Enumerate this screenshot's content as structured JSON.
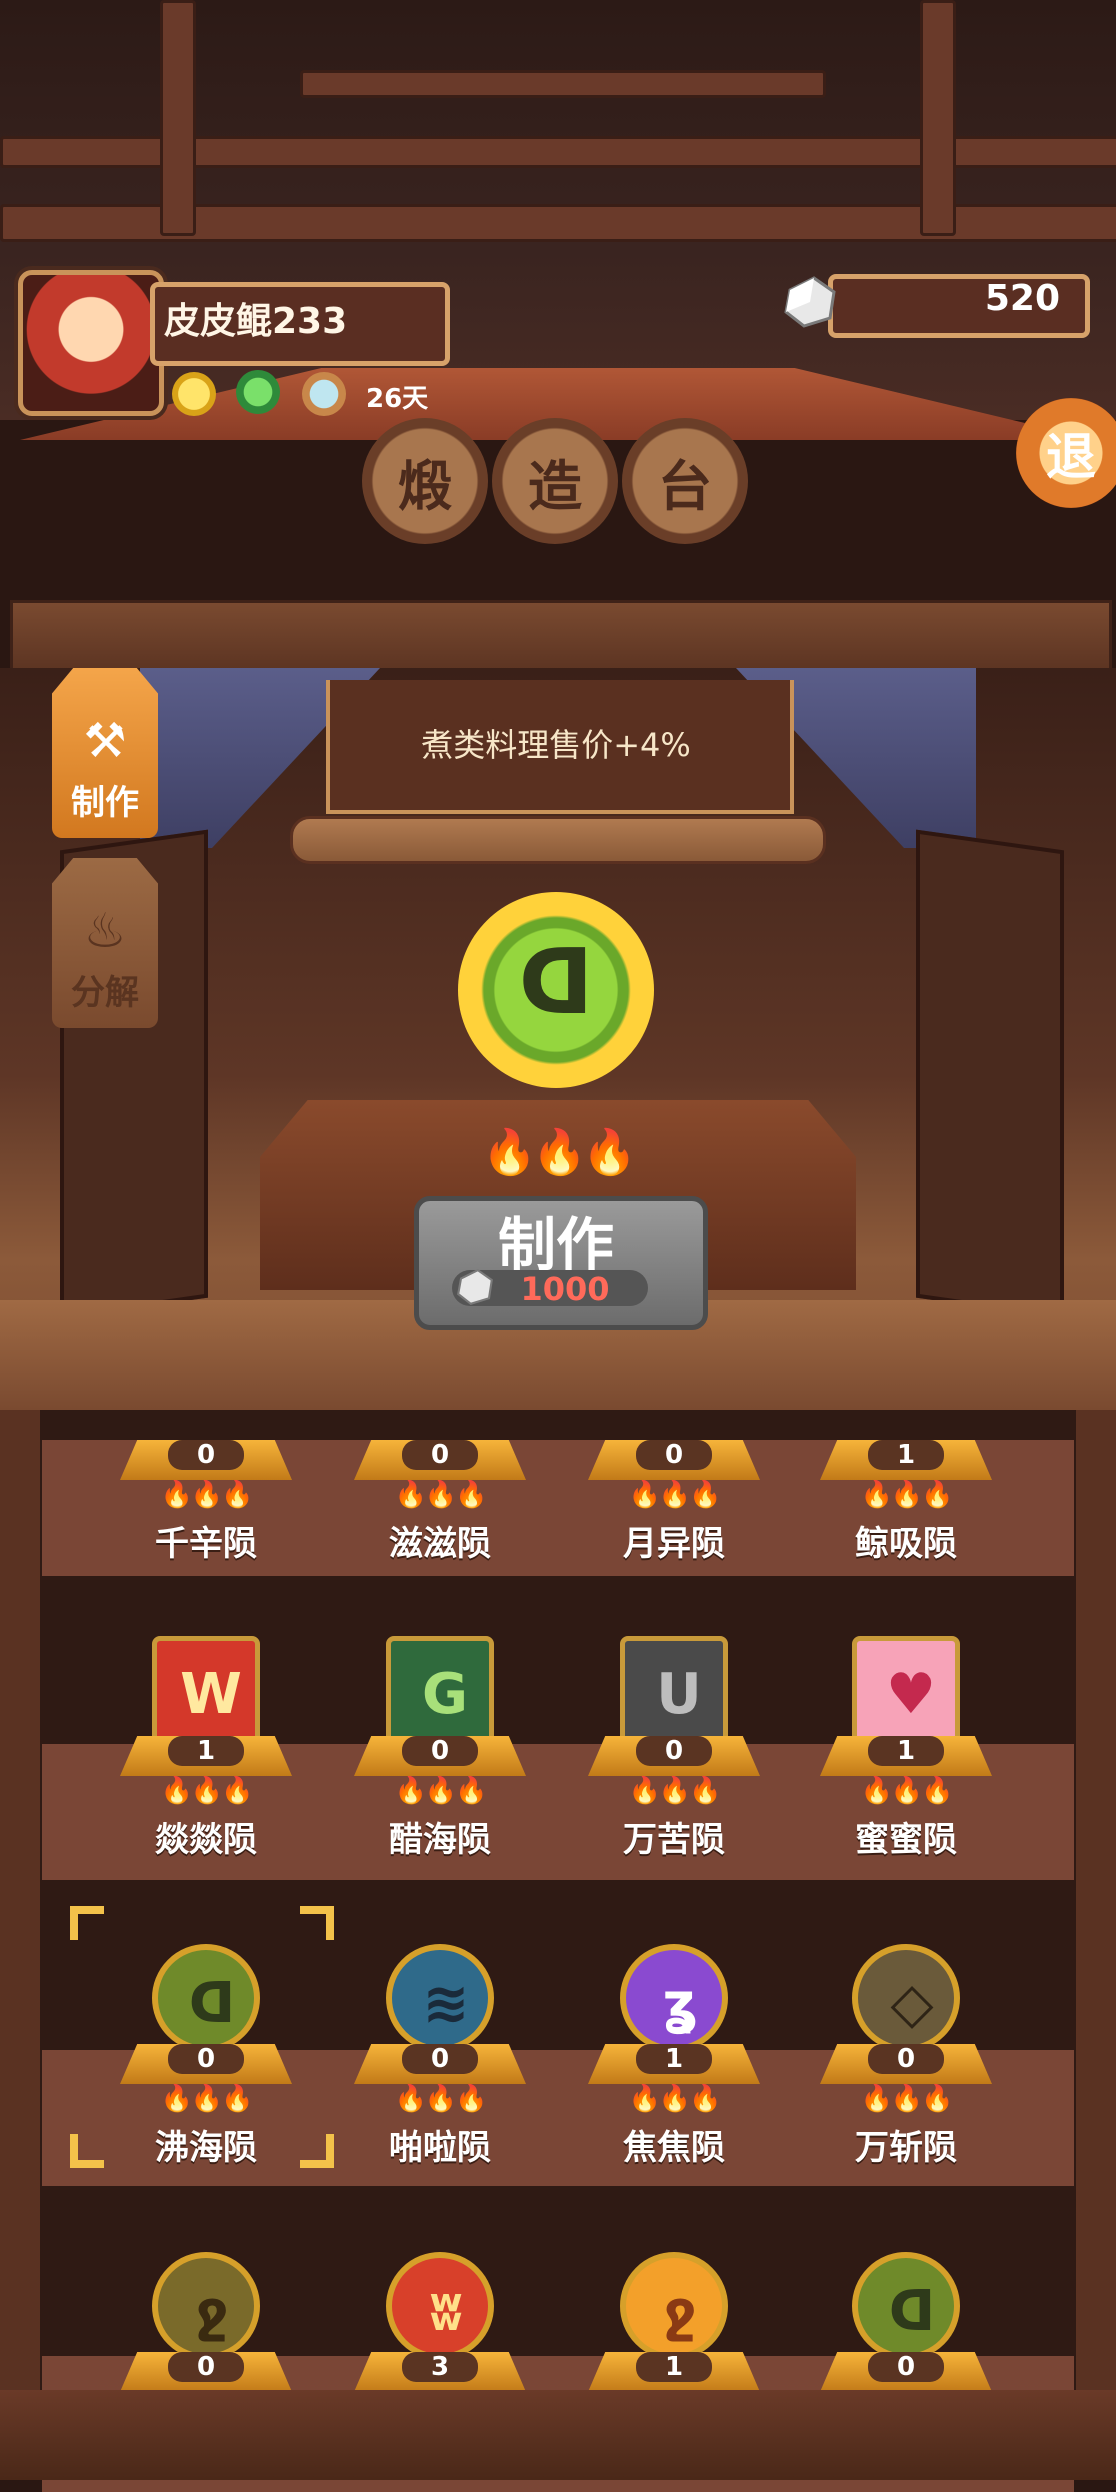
{
  "player": {
    "name": "皮皮鲲233",
    "days": "26天",
    "stone_count": "520",
    "exit_label": "退"
  },
  "title_tokens": [
    "煅",
    "造",
    "台"
  ],
  "side_tabs": [
    {
      "label": "制作",
      "icon": "hammer-icon",
      "active": true
    },
    {
      "label": "分解",
      "icon": "flame-icon",
      "active": false
    }
  ],
  "bonus": {
    "text": "煮类料理售价+4%"
  },
  "selected_item": {
    "glyph": "ᗡ",
    "flames": "🔥🔥🔥"
  },
  "craft": {
    "label": "制作",
    "cost": "1000"
  },
  "items": [
    {
      "name": "千辛陨",
      "count": "0",
      "flames": "🔥🔥🔥",
      "glyph": "",
      "shape": "partial",
      "bg": "#d8a03a",
      "fg": "#fff"
    },
    {
      "name": "滋滋陨",
      "count": "0",
      "flames": "🔥🔥🔥",
      "glyph": "",
      "shape": "partial",
      "bg": "#d8a03a",
      "fg": "#fff"
    },
    {
      "name": "月异陨",
      "count": "0",
      "flames": "🔥🔥🔥",
      "glyph": "",
      "shape": "partial",
      "bg": "#d8a03a",
      "fg": "#fff"
    },
    {
      "name": "鲸吸陨",
      "count": "1",
      "flames": "🔥🔥🔥",
      "glyph": "",
      "shape": "partial",
      "bg": "#d8a03a",
      "fg": "#fff"
    },
    {
      "name": "燚燚陨",
      "count": "1",
      "flames": "🔥🔥🔥",
      "glyph": "W",
      "shape": "sq",
      "bg": "#d4382a",
      "fg": "#ffe9a0"
    },
    {
      "name": "醋海陨",
      "count": "0",
      "flames": "🔥🔥🔥",
      "glyph": "G",
      "shape": "sq",
      "bg": "#2f6a3c",
      "fg": "#a8e07a"
    },
    {
      "name": "万苦陨",
      "count": "0",
      "flames": "🔥🔥🔥",
      "glyph": "U",
      "shape": "sq",
      "bg": "#4a4a4a",
      "fg": "#bdbdbd"
    },
    {
      "name": "蜜蜜陨",
      "count": "1",
      "flames": "🔥🔥🔥",
      "glyph": "♥",
      "shape": "sq",
      "bg": "#f7a3b8",
      "fg": "#c4294e"
    },
    {
      "name": "沸海陨",
      "count": "0",
      "flames": "🔥🔥🔥",
      "glyph": "ᗡ",
      "shape": "circ",
      "bg": "#6f8a2a",
      "fg": "#2e3a1a",
      "selected": true
    },
    {
      "name": "啪啦陨",
      "count": "0",
      "flames": "🔥🔥🔥",
      "glyph": "≋",
      "shape": "circ",
      "bg": "#2f6a8a",
      "fg": "#1a2a3a"
    },
    {
      "name": "焦焦陨",
      "count": "1",
      "flames": "🔥🔥🔥",
      "glyph": "ʓ",
      "shape": "circ",
      "bg": "#8a4ad0",
      "fg": "#fff"
    },
    {
      "name": "万斩陨",
      "count": "0",
      "flames": "🔥🔥🔥",
      "glyph": "◇",
      "shape": "circ",
      "bg": "#6a5a3a",
      "fg": "#2e2416"
    },
    {
      "name": "",
      "count": "0",
      "flames": "",
      "glyph": "ջ",
      "shape": "circ",
      "bg": "#7a6a2a",
      "fg": "#3a2a10"
    },
    {
      "name": "",
      "count": "3",
      "flames": "",
      "glyph": "ʬ",
      "shape": "circ",
      "bg": "#d8402a",
      "fg": "#ffe08a"
    },
    {
      "name": "",
      "count": "1",
      "flames": "",
      "glyph": "ջ",
      "shape": "circ",
      "bg": "#f3a02a",
      "fg": "#8a3a14"
    },
    {
      "name": "",
      "count": "0",
      "flames": "",
      "glyph": "ᗡ",
      "shape": "circ",
      "bg": "#6f8a2a",
      "fg": "#2e3a1a"
    }
  ]
}
